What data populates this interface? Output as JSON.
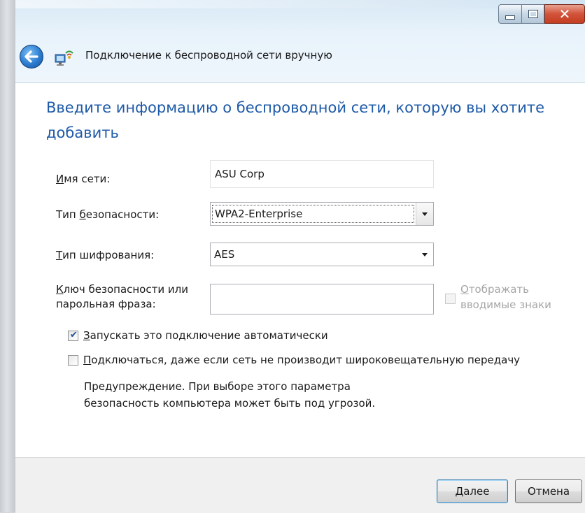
{
  "window": {
    "title": "Подключение к беспроводной сети вручную",
    "icons": {
      "back": "back-arrow-icon",
      "wizard": "network-wizard-icon",
      "minimize": "minimize-icon",
      "maximize": "maximize-icon",
      "close": "close-icon"
    },
    "close_glyph": "✕"
  },
  "heading": "Введите информацию о беспроводной сети, которую вы хотите добавить",
  "form": {
    "network_name": {
      "label_mnemonic": "И",
      "label_rest": "мя сети:",
      "value": "ASU Corp"
    },
    "security_type": {
      "label_pre": "Тип ",
      "label_mnemonic": "б",
      "label_rest": "езопасности:",
      "value": "WPA2-Enterprise"
    },
    "encryption_type": {
      "label_mnemonic": "Т",
      "label_rest": "ип шифрования:",
      "value": "AES"
    },
    "security_key": {
      "label_line1_mnemonic": "К",
      "label_line1_rest": "люч безопасности или",
      "label_line2": "парольная фраза:",
      "value": ""
    },
    "show_chars": {
      "label_line1_mnemonic": "О",
      "label_line1_rest": "тображать",
      "label_line2": "вводимые знаки",
      "checked": false,
      "enabled": false
    }
  },
  "options": {
    "auto_start": {
      "mnemonic": "З",
      "rest": "апускать это подключение автоматически",
      "checked": true
    },
    "connect_hidden": {
      "mnemonic": "П",
      "rest": "одключаться, даже если сеть не производит широковещательную передачу",
      "checked": false
    },
    "warning_line1": "Предупреждение. При выборе этого параметра",
    "warning_line2": "безопасность компьютера может быть под угрозой."
  },
  "buttons": {
    "next": {
      "mnemonic": "Д",
      "rest": "алее"
    },
    "cancel": {
      "label": "Отмена"
    }
  },
  "colors": {
    "heading": "#1e5aa8",
    "check": "#1c4f9c"
  }
}
